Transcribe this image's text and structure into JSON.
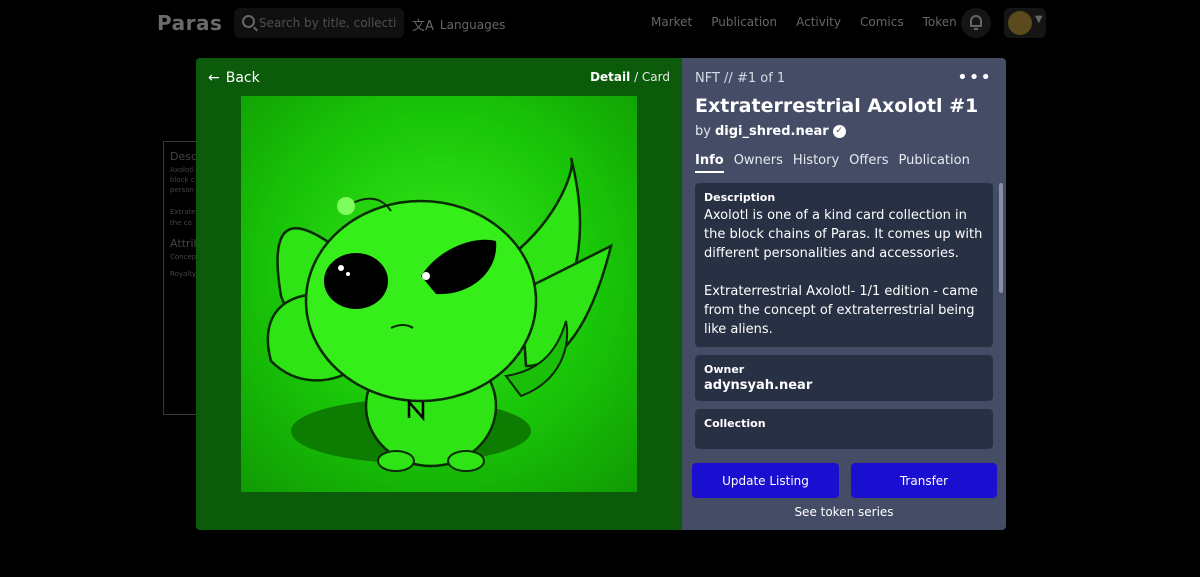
{
  "header": {
    "logo": "Paras",
    "search_placeholder": "Search by title, collecti",
    "languages_label": "Languages",
    "nav": [
      "Market",
      "Publication",
      "Activity",
      "Comics",
      "Token"
    ]
  },
  "background_card": {
    "lines": [
      "Desc",
      "Axolotl",
      "block c",
      "person",
      "Extrate",
      "the co",
      "Attrib",
      "Concep",
      "Royalty"
    ]
  },
  "modal": {
    "back_label": "Back",
    "view_toggle": {
      "active": "Detail",
      "separator": " / ",
      "other": "Card"
    },
    "artwork_bg": "#1ec80b",
    "nft_label": "NFT // #1 of 1",
    "title": "Extraterrestrial Axolotl #1",
    "by_prefix": "by",
    "creator": "digi_shred.near",
    "tabs": [
      "Info",
      "Owners",
      "History",
      "Offers",
      "Publication"
    ],
    "description_label": "Description",
    "description": "Axolotl is one of a kind card collection in the block chains of Paras. It comes up with different personalities and accessories.\n\nExtraterrestrial Axolotl- 1/1 edition - came from the concept of extraterrestrial being like aliens.",
    "owner_label": "Owner",
    "owner": "adynsyah.near",
    "collection_label": "Collection",
    "update_listing_label": "Update Listing",
    "transfer_label": "Transfer",
    "see_series_label": "See token series"
  },
  "colors": {
    "button_primary": "#1a0fd0",
    "panel_bg": "#454d66",
    "box_bg": "#283044",
    "modal_left_bg": "#0b5b0b"
  }
}
